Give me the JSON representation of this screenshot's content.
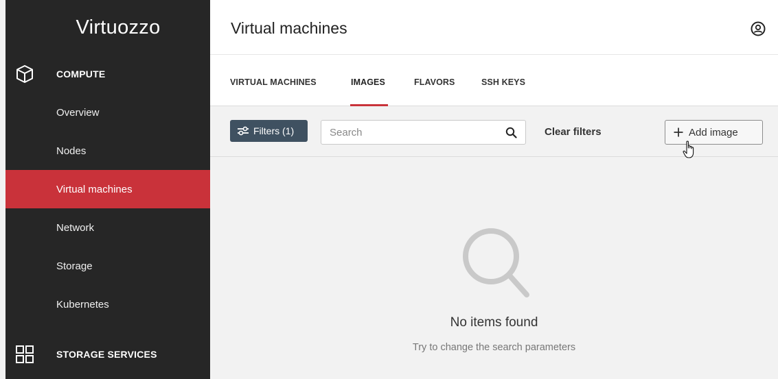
{
  "brand": {
    "name": "Virtuozzo"
  },
  "sidebar": {
    "sections": [
      {
        "label": "COMPUTE",
        "icon": "cube-icon"
      },
      {
        "label": "STORAGE SERVICES",
        "icon": "grid-icon"
      }
    ],
    "items": [
      {
        "label": "Overview"
      },
      {
        "label": "Nodes"
      },
      {
        "label": "Virtual machines",
        "active": true
      },
      {
        "label": "Network"
      },
      {
        "label": "Storage"
      },
      {
        "label": "Kubernetes"
      }
    ]
  },
  "header": {
    "title": "Virtual machines",
    "user_icon": "user-circle-icon"
  },
  "tabs": [
    {
      "label": "VIRTUAL MACHINES"
    },
    {
      "label": "IMAGES",
      "active": true
    },
    {
      "label": "FLAVORS"
    },
    {
      "label": "SSH KEYS"
    }
  ],
  "toolbar": {
    "filters_label": "Filters (1)",
    "search_placeholder": "Search",
    "clear_filters_label": "Clear filters",
    "add_image_label": "Add image"
  },
  "empty_state": {
    "title": "No items found",
    "subtitle": "Try to change the search parameters"
  },
  "colors": {
    "accent": "#c9323a",
    "sidebar": "#262626",
    "filters_button": "#3f5161"
  }
}
